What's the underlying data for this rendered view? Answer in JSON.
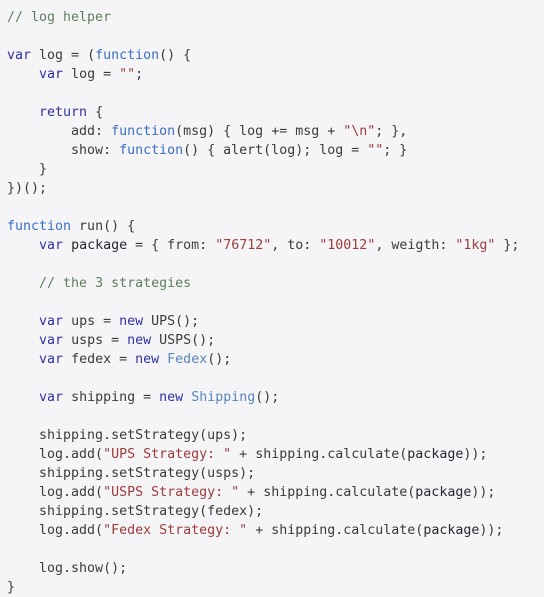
{
  "document": {
    "kind": "source-code-listing",
    "language": "javascript",
    "title": "log helper / strategy pattern example",
    "background_color": "#f5f5f7",
    "font_size_px": 13.3,
    "line_height_px": 19,
    "colors": {
      "plain": "#3b3b3b",
      "comment": "#5d7f5d",
      "keyword": "#2f2fa0",
      "function": "#3a6fc4",
      "class": "#5a86bd",
      "string": "#9c3b3b",
      "variable": "#4a4ad4"
    }
  },
  "code": {
    "lines": [
      {
        "n": 1,
        "text": "// log helper",
        "tokens": [
          {
            "t": "// log helper",
            "c": "comment"
          }
        ]
      },
      {
        "n": 2,
        "text": "",
        "tokens": []
      },
      {
        "n": 3,
        "text": "var log = (function() {",
        "tokens": [
          {
            "t": "var",
            "c": "keyword"
          },
          {
            "t": " log = (",
            "c": "plain"
          },
          {
            "t": "function",
            "c": "function"
          },
          {
            "t": "() {",
            "c": "plain"
          }
        ]
      },
      {
        "n": 4,
        "text": "    var log = \"\";",
        "tokens": [
          {
            "t": "    ",
            "c": "plain"
          },
          {
            "t": "var",
            "c": "keyword"
          },
          {
            "t": " log = ",
            "c": "plain"
          },
          {
            "t": "\"\"",
            "c": "string"
          },
          {
            "t": ";",
            "c": "plain"
          }
        ]
      },
      {
        "n": 5,
        "text": "",
        "tokens": []
      },
      {
        "n": 6,
        "text": "    return {",
        "tokens": [
          {
            "t": "    ",
            "c": "plain"
          },
          {
            "t": "return",
            "c": "keyword"
          },
          {
            "t": " {",
            "c": "plain"
          }
        ]
      },
      {
        "n": 7,
        "text": "        add: function(msg) { log += msg + \"\\n\"; },",
        "tokens": [
          {
            "t": "        add: ",
            "c": "plain"
          },
          {
            "t": "function",
            "c": "function"
          },
          {
            "t": "(msg) { log += msg + ",
            "c": "plain"
          },
          {
            "t": "\"\\n\"",
            "c": "string"
          },
          {
            "t": "; },",
            "c": "plain"
          }
        ]
      },
      {
        "n": 8,
        "text": "        show: function() { alert(log); log = \"\"; }",
        "tokens": [
          {
            "t": "        show: ",
            "c": "plain"
          },
          {
            "t": "function",
            "c": "function"
          },
          {
            "t": "() { alert(log); log = ",
            "c": "plain"
          },
          {
            "t": "\"\"",
            "c": "string"
          },
          {
            "t": "; }",
            "c": "plain"
          }
        ]
      },
      {
        "n": 9,
        "text": "    }",
        "tokens": [
          {
            "t": "    }",
            "c": "plain"
          }
        ]
      },
      {
        "n": 10,
        "text": "})();",
        "tokens": [
          {
            "t": "})();",
            "c": "plain"
          }
        ]
      },
      {
        "n": 11,
        "text": "",
        "tokens": []
      },
      {
        "n": 12,
        "text": "function run() {",
        "tokens": [
          {
            "t": "function",
            "c": "function"
          },
          {
            "t": " run() {",
            "c": "plain"
          }
        ]
      },
      {
        "n": 13,
        "text": "    var package = { from: \"76712\", to: \"10012\", weigth: \"1kg\" };",
        "tokens": [
          {
            "t": "    ",
            "c": "plain"
          },
          {
            "t": "var",
            "c": "keyword"
          },
          {
            "t": " ",
            "c": "plain"
          },
          {
            "t": "package",
            "c": "variable"
          },
          {
            "t": " = { from: ",
            "c": "plain"
          },
          {
            "t": "\"76712\"",
            "c": "string"
          },
          {
            "t": ", to: ",
            "c": "plain"
          },
          {
            "t": "\"10012\"",
            "c": "string"
          },
          {
            "t": ", weigth: ",
            "c": "plain"
          },
          {
            "t": "\"1kg\"",
            "c": "string"
          },
          {
            "t": " };",
            "c": "plain"
          }
        ]
      },
      {
        "n": 14,
        "text": "",
        "tokens": []
      },
      {
        "n": 15,
        "text": "    // the 3 strategies",
        "tokens": [
          {
            "t": "    ",
            "c": "plain"
          },
          {
            "t": "// the 3 strategies",
            "c": "comment"
          }
        ]
      },
      {
        "n": 16,
        "text": "",
        "tokens": []
      },
      {
        "n": 17,
        "text": "    var ups = new UPS();",
        "tokens": [
          {
            "t": "    ",
            "c": "plain"
          },
          {
            "t": "var",
            "c": "keyword"
          },
          {
            "t": " ups = ",
            "c": "plain"
          },
          {
            "t": "new",
            "c": "keyword"
          },
          {
            "t": " UPS();",
            "c": "plain"
          }
        ]
      },
      {
        "n": 18,
        "text": "    var usps = new USPS();",
        "tokens": [
          {
            "t": "    ",
            "c": "plain"
          },
          {
            "t": "var",
            "c": "keyword"
          },
          {
            "t": " usps = ",
            "c": "plain"
          },
          {
            "t": "new",
            "c": "keyword"
          },
          {
            "t": " USPS();",
            "c": "plain"
          }
        ]
      },
      {
        "n": 19,
        "text": "    var fedex = new Fedex();",
        "tokens": [
          {
            "t": "    ",
            "c": "plain"
          },
          {
            "t": "var",
            "c": "keyword"
          },
          {
            "t": " fedex = ",
            "c": "plain"
          },
          {
            "t": "new",
            "c": "keyword"
          },
          {
            "t": " ",
            "c": "plain"
          },
          {
            "t": "Fedex",
            "c": "class"
          },
          {
            "t": "();",
            "c": "plain"
          }
        ]
      },
      {
        "n": 20,
        "text": "",
        "tokens": []
      },
      {
        "n": 21,
        "text": "    var shipping = new Shipping();",
        "tokens": [
          {
            "t": "    ",
            "c": "plain"
          },
          {
            "t": "var",
            "c": "keyword"
          },
          {
            "t": " shipping = ",
            "c": "plain"
          },
          {
            "t": "new",
            "c": "keyword"
          },
          {
            "t": " ",
            "c": "plain"
          },
          {
            "t": "Shipping",
            "c": "class"
          },
          {
            "t": "();",
            "c": "plain"
          }
        ]
      },
      {
        "n": 22,
        "text": "",
        "tokens": []
      },
      {
        "n": 23,
        "text": "    shipping.setStrategy(ups);",
        "tokens": [
          {
            "t": "    shipping.setStrategy(ups);",
            "c": "plain"
          }
        ]
      },
      {
        "n": 24,
        "text": "    log.add(\"UPS Strategy: \" + shipping.calculate(package));",
        "tokens": [
          {
            "t": "    log.add(",
            "c": "plain"
          },
          {
            "t": "\"UPS Strategy: \"",
            "c": "string"
          },
          {
            "t": " + shipping.calculate(",
            "c": "plain"
          },
          {
            "t": "package",
            "c": "variable"
          },
          {
            "t": "));",
            "c": "plain"
          }
        ]
      },
      {
        "n": 25,
        "text": "    shipping.setStrategy(usps);",
        "tokens": [
          {
            "t": "    shipping.setStrategy(usps);",
            "c": "plain"
          }
        ]
      },
      {
        "n": 26,
        "text": "    log.add(\"USPS Strategy: \" + shipping.calculate(package));",
        "tokens": [
          {
            "t": "    log.add(",
            "c": "plain"
          },
          {
            "t": "\"USPS Strategy: \"",
            "c": "string"
          },
          {
            "t": " + shipping.calculate(",
            "c": "plain"
          },
          {
            "t": "package",
            "c": "variable"
          },
          {
            "t": "));",
            "c": "plain"
          }
        ]
      },
      {
        "n": 27,
        "text": "    shipping.setStrategy(fedex);",
        "tokens": [
          {
            "t": "    shipping.setStrategy(fedex);",
            "c": "plain"
          }
        ]
      },
      {
        "n": 28,
        "text": "    log.add(\"Fedex Strategy: \" + shipping.calculate(package));",
        "tokens": [
          {
            "t": "    log.add(",
            "c": "plain"
          },
          {
            "t": "\"Fedex Strategy: \"",
            "c": "string"
          },
          {
            "t": " + shipping.calculate(",
            "c": "plain"
          },
          {
            "t": "package",
            "c": "variable"
          },
          {
            "t": "));",
            "c": "plain"
          }
        ]
      },
      {
        "n": 29,
        "text": "",
        "tokens": []
      },
      {
        "n": 30,
        "text": "    log.show();",
        "tokens": [
          {
            "t": "    log.show();",
            "c": "plain"
          }
        ]
      },
      {
        "n": 31,
        "text": "}",
        "tokens": [
          {
            "t": "}",
            "c": "plain"
          }
        ]
      }
    ]
  }
}
